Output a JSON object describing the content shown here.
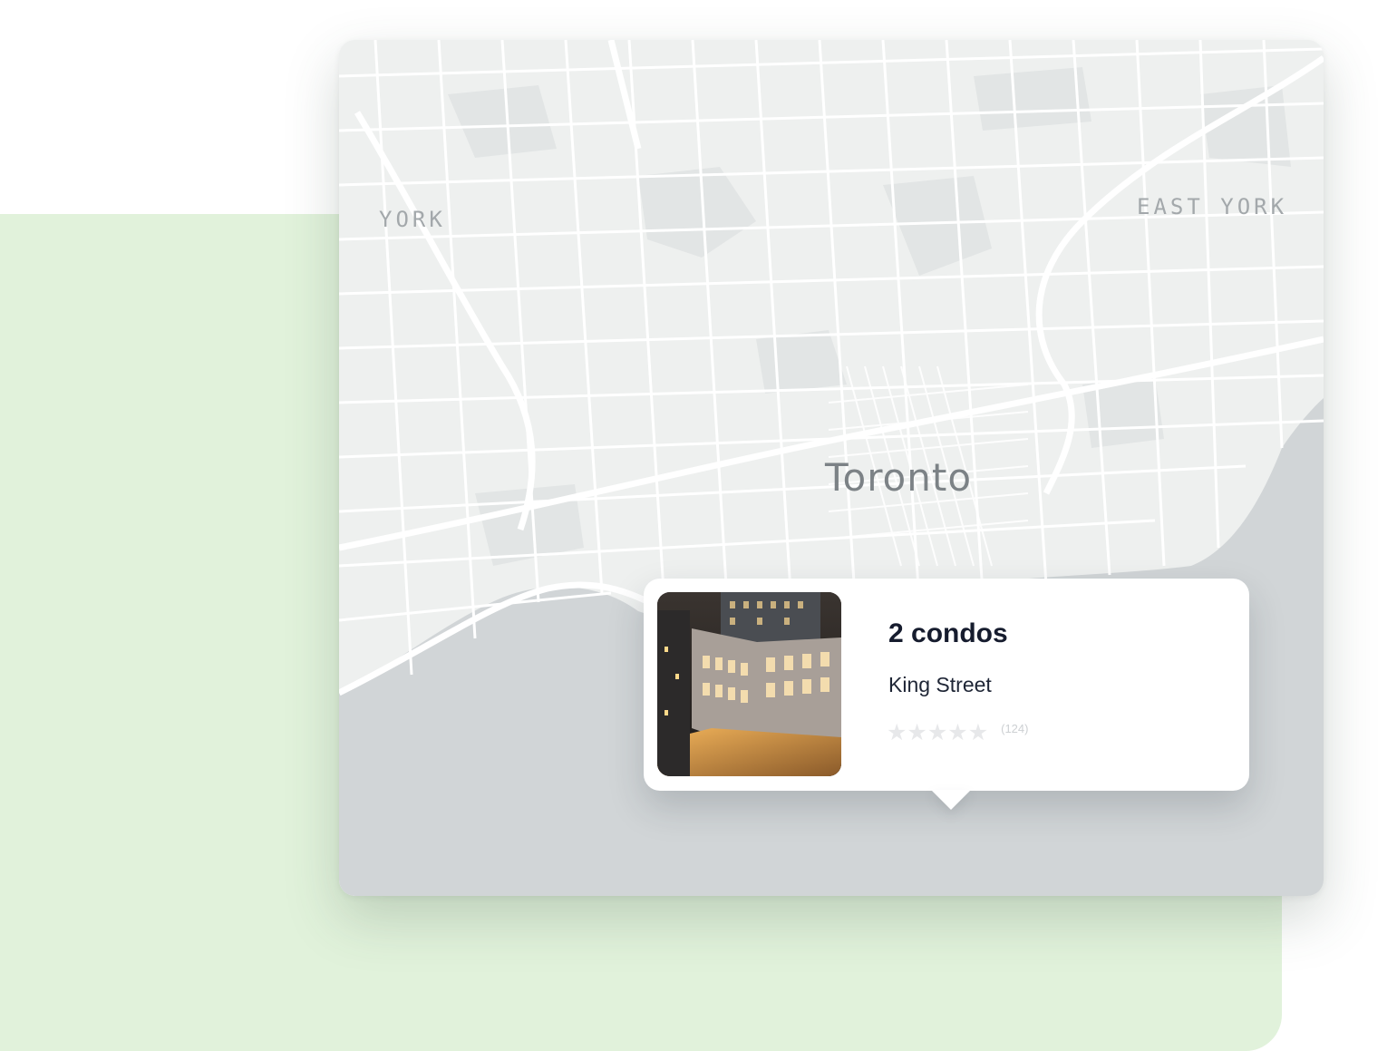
{
  "map": {
    "labels": {
      "york": "YORK",
      "east_york": "EAST YORK",
      "toronto": "Toronto"
    },
    "colors": {
      "land": "#eef0ef",
      "water": "#d1d5d7",
      "roads": "#ffffff",
      "parks": "#e2e5e5"
    }
  },
  "popup": {
    "title": "2 condos",
    "subtitle": "King Street",
    "rating": {
      "stars_filled": 0,
      "stars_total": 5,
      "count_label": "(124)"
    },
    "image_icon": "building-photo"
  },
  "theme": {
    "accent_bg": "#e1f2db",
    "title_color": "#161c2e"
  }
}
